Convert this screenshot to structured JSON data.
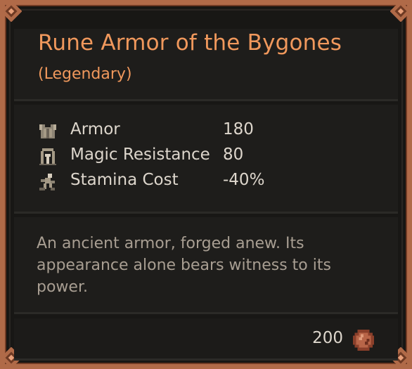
{
  "item": {
    "name": "Rune Armor of the Bygones",
    "rarity": "(Legendary)",
    "rarity_color": "#f0985c"
  },
  "stats": [
    {
      "icon": "armor-icon",
      "label": "Armor",
      "value": "180"
    },
    {
      "icon": "magic-resistance-icon",
      "label": "Magic Resistance",
      "value": "80"
    },
    {
      "icon": "stamina-cost-icon",
      "label": "Stamina Cost",
      "value": "-40%"
    }
  ],
  "description": "An ancient armor, forged anew. Its appearance alone bears witness to its power.",
  "price": {
    "value": "200",
    "icon": "coin-icon"
  },
  "colors": {
    "frame": "#b06a48",
    "background": "#181715",
    "text": "#ddd6cc",
    "description_text": "#a89e92"
  }
}
